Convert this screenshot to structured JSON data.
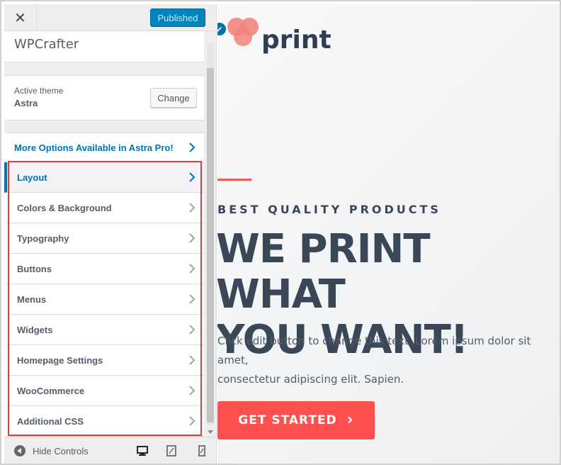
{
  "header": {
    "close_symbol": "✕",
    "publish_label": "Published"
  },
  "site": {
    "title": "WPCrafter"
  },
  "theme": {
    "label": "Active theme",
    "name": "Astra",
    "change_label": "Change"
  },
  "pro_link": {
    "label": "More Options Available in Astra Pro!"
  },
  "menu": {
    "items": [
      {
        "label": "Layout",
        "active": true
      },
      {
        "label": "Colors & Background"
      },
      {
        "label": "Typography"
      },
      {
        "label": "Buttons"
      },
      {
        "label": "Menus"
      },
      {
        "label": "Widgets"
      },
      {
        "label": "Homepage Settings"
      },
      {
        "label": "WooCommerce"
      },
      {
        "label": "Additional CSS"
      }
    ]
  },
  "footer": {
    "hide_label": "Hide Controls",
    "devices": [
      "desktop-icon",
      "tablet-icon",
      "mobile-icon"
    ]
  },
  "preview": {
    "logo_text": "print",
    "kicker": "BEST QUALITY PRODUCTS",
    "headline_line1": "WE PRINT WHAT",
    "headline_line2": "YOU WANT!",
    "body_line1": "Click edit button to change this text. Lorem ipsum dolor sit amet,",
    "body_line2": "consectetur adipiscing elit. Sapien.",
    "cta_label": "GET STARTED",
    "cta_arrow": "›"
  },
  "colors": {
    "accent_blue": "#0073aa",
    "publish_blue": "#0085ba",
    "highlight_red": "#e03a3a",
    "cta_red": "#ff5050",
    "headline_dark": "#3a4756"
  }
}
